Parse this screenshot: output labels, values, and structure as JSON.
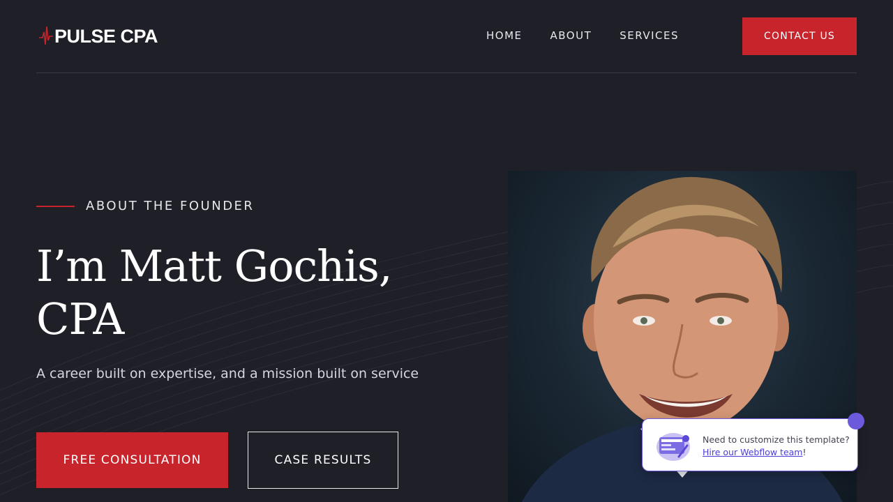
{
  "brand": {
    "name": "PULSE CPA",
    "accent_color": "#c8242c",
    "background_color": "#1f1f28"
  },
  "nav": {
    "items": [
      {
        "label": "HOME"
      },
      {
        "label": "ABOUT"
      },
      {
        "label": "SERVICES"
      }
    ],
    "contact_label": "CONTACT US"
  },
  "hero": {
    "eyebrow": "ABOUT THE FOUNDER",
    "title_line1": "I’m Matt Gochis,",
    "title_line2": "CPA",
    "subtitle": "A career built on expertise, and a mission built on service",
    "primary_button": "FREE CONSULTATION",
    "secondary_button": "CASE RESULTS"
  },
  "portrait": {
    "icon": "founder-portrait-image"
  },
  "webflow_widget": {
    "text": "Need to customize this template?",
    "link_text": "Hire our Webflow team",
    "link_suffix": "!",
    "icon": "webflow-template-icon"
  }
}
